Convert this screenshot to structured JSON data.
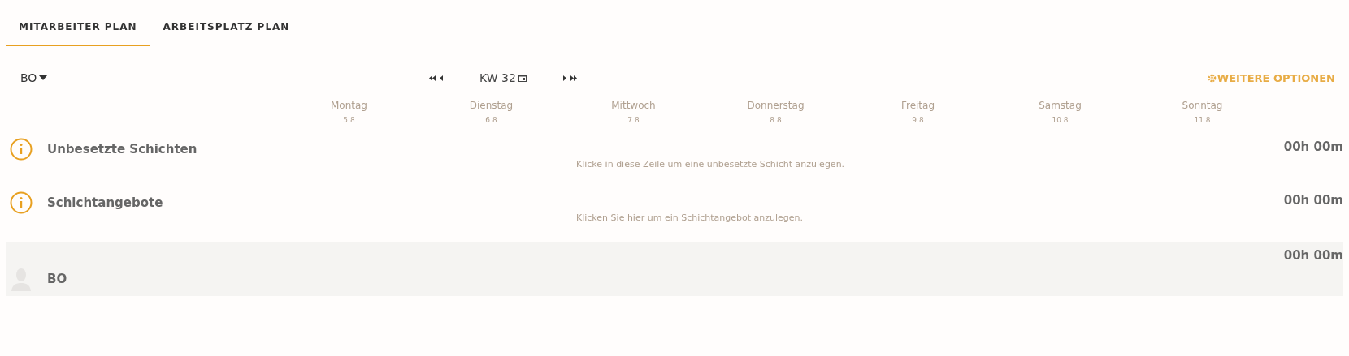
{
  "tabs": [
    {
      "label": "MITARBEITER PLAN",
      "selected": true
    },
    {
      "label": "ARBEITSPLATZ PLAN",
      "selected": false
    }
  ],
  "toolbar": {
    "filter": "BO",
    "week": "KW 32",
    "options": "WEITERE OPTIONEN"
  },
  "days": [
    {
      "name": "Montag",
      "date": "5.8"
    },
    {
      "name": "Dienstag",
      "date": "6.8"
    },
    {
      "name": "Mittwoch",
      "date": "7.8"
    },
    {
      "name": "Donnerstag",
      "date": "8.8"
    },
    {
      "name": "Freitag",
      "date": "9.8"
    },
    {
      "name": "Samstag",
      "date": "10.8"
    },
    {
      "name": "Sonntag",
      "date": "11.8"
    }
  ],
  "rows": [
    {
      "kind": "info",
      "name": "Unbesetzte Schichten",
      "hint": "Klicke in diese Zeile um eine unbesetzte Schicht anzulegen.",
      "total": "00h 00m"
    },
    {
      "kind": "info",
      "name": "Schichtangebote",
      "hint": "Klicken Sie hier um ein Schichtangebot anzulegen.",
      "total": "00h 00m"
    },
    {
      "kind": "person",
      "name": "BO",
      "total": "00h 00m"
    }
  ]
}
